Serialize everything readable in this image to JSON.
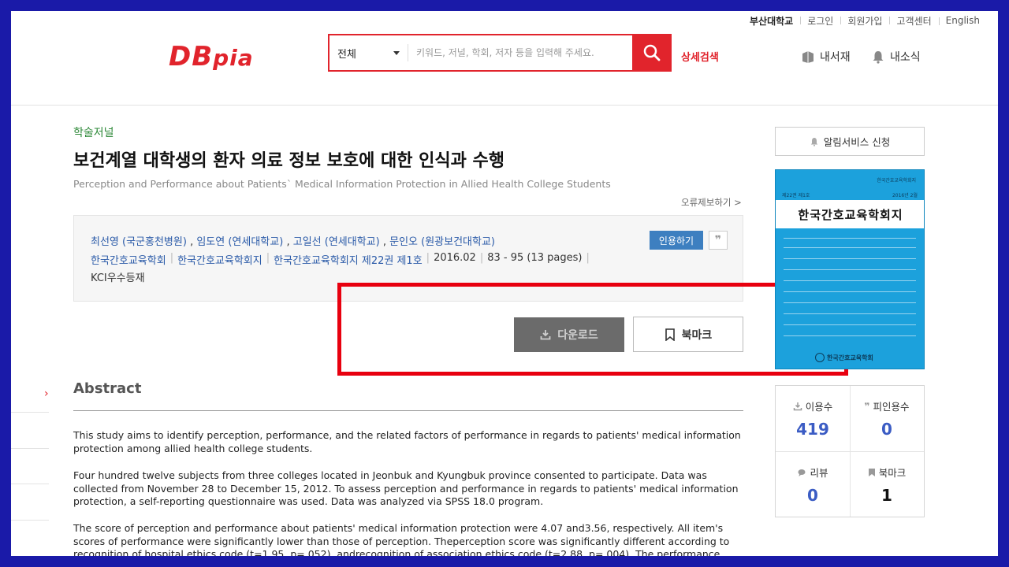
{
  "topbar": {
    "university": "부산대학교",
    "login": "로그인",
    "signup": "회원가입",
    "support": "고객센터",
    "english": "English"
  },
  "logo": {
    "part1": "DB",
    "part2": "pia"
  },
  "search": {
    "scope": "전체",
    "placeholder": "키워드, 저널, 학회, 저자 등을 입력해 주세요.",
    "advanced": "상세검색"
  },
  "header_links": {
    "my_library": "내서재",
    "notifications": "내소식"
  },
  "article": {
    "category": "학술저널",
    "title": "보건계열 대학생의 환자 의료 정보 보호에 대한 인식과 수행",
    "subtitle": "Perception and Performance about Patients` Medical Information Protection in Allied Health College Students",
    "report_error": "오류제보하기 >",
    "authors": [
      "최선영 (국군홍천병원)",
      "임도연 (연세대학교)",
      "고일선 (연세대학교)",
      "문인오 (원광보건대학교)"
    ],
    "author_sep": ",",
    "publisher": "한국간호교육학회",
    "journal": "한국간호교육학회지",
    "volume": "한국간호교육학회지 제22권 제1호",
    "date": "2016.02",
    "pages": "83 - 95 (13 pages)",
    "kci": "KCI우수등재",
    "cite_label": "인용하기",
    "quote_glyph": "❞",
    "download_label": "다운로드",
    "bookmark_label": "북마크"
  },
  "abstract": {
    "heading": "Abstract",
    "paragraphs": [
      "This study aims to identify perception, performance, and the related factors of performance in regards to patients' medical information protection among allied health college students.",
      "Four hundred twelve subjects from three colleges located in Jeonbuk and Kyungbuk province consented to participate. Data was collected from November 28 to December 15, 2012. To assess perception and performance in regards to patients' medical information protection, a self-reporting questionnaire was used. Data was analyzed via SPSS 18.0 program.",
      "The score of perception and performance about patients' medical information protection were 4.07 and3.56, respectively. All item's scores of performance were significantly lower than those of perception. Theperception score was significantly different according to recognition of hospital ethics code (t=1.95, p=.052), andrecognition of association ethics code (t=2.88, p=.004). The performance score was significantly"
    ]
  },
  "sidebar": {
    "alert_label": "알림서비스 신청",
    "cover": {
      "corner": "한국간호교육학회지",
      "issue": "제22권 제1호",
      "date": "2016년 2월",
      "journal_title": "한국간호교육학회지",
      "publisher": "한국간호교육학회"
    },
    "stats": {
      "usage_label": "이용수",
      "usage_value": "419",
      "cited_label": "피인용수",
      "cited_value": "0",
      "review_label": "리뷰",
      "review_value": "0",
      "bookmark_label": "북마크",
      "bookmark_value": "1"
    }
  },
  "colors": {
    "brand_red": "#e1242c",
    "link_blue": "#2a5aa8",
    "category_green": "#2f8a3a",
    "frame_blue": "#1a1aa8",
    "highlight_red": "#e8000f"
  }
}
